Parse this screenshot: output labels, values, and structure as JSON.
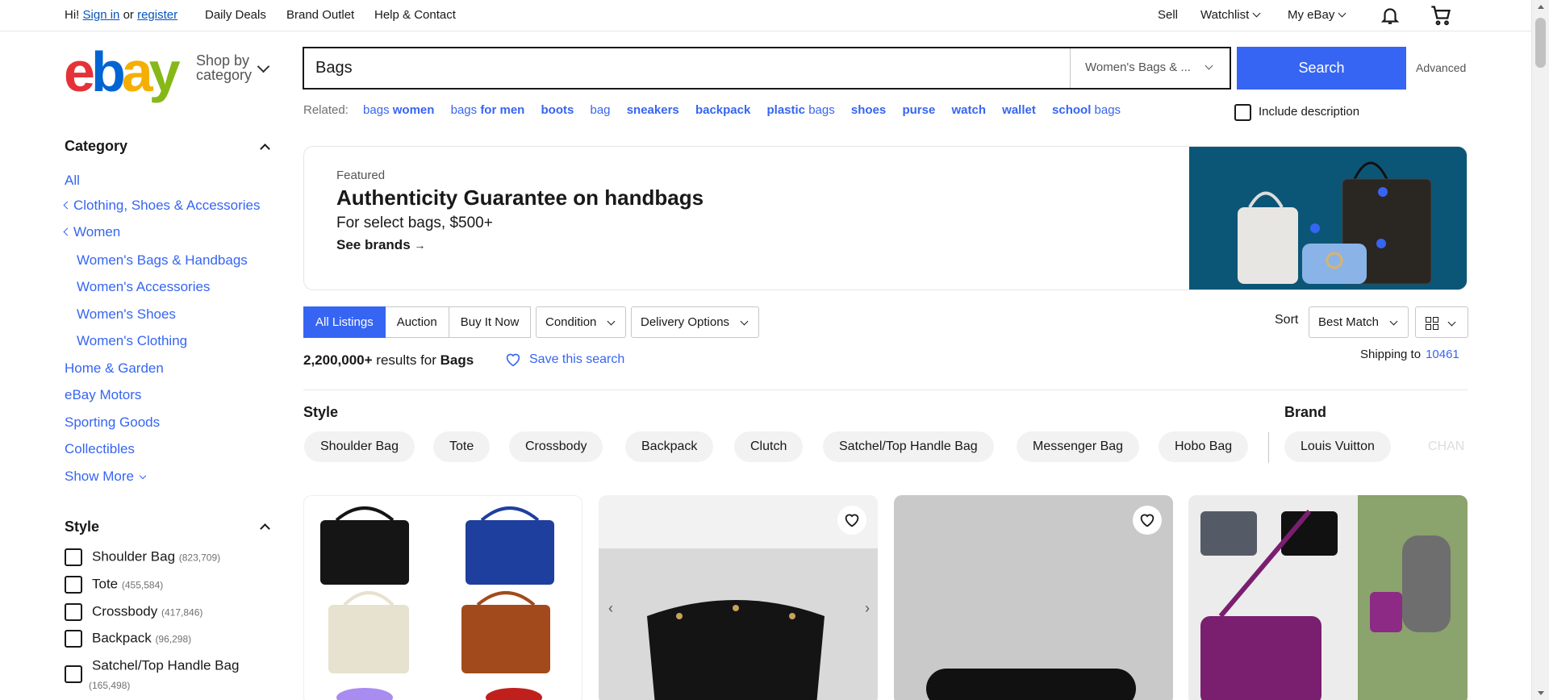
{
  "topbar": {
    "greeting": "Hi!",
    "sign_in": "Sign in",
    "or": "or",
    "register": "register",
    "daily_deals": "Daily Deals",
    "brand_outlet": "Brand Outlet",
    "help_contact": "Help & Contact",
    "sell": "Sell",
    "watchlist": "Watchlist",
    "my_ebay": "My eBay",
    "notification_icon": "bell-icon",
    "cart_icon": "cart-icon"
  },
  "header": {
    "logo": "ebay",
    "shop_by_category_line1": "Shop by",
    "shop_by_category_line2": "category"
  },
  "search": {
    "value": "Bags",
    "category_selected": "Women's Bags & ...",
    "button": "Search",
    "advanced": "Advanced"
  },
  "related": {
    "label": "Related:",
    "items": [
      {
        "pre": "bags ",
        "bold": "women",
        "post": ""
      },
      {
        "pre": "bags ",
        "bold": "for men",
        "post": ""
      },
      {
        "pre": "",
        "bold": "boots",
        "post": ""
      },
      {
        "pre": "bag",
        "bold": "",
        "post": ""
      },
      {
        "pre": "",
        "bold": "sneakers",
        "post": ""
      },
      {
        "pre": "",
        "bold": "backpack",
        "post": ""
      },
      {
        "pre": "",
        "bold": "plastic",
        "post": " bags"
      },
      {
        "pre": "",
        "bold": "shoes",
        "post": ""
      },
      {
        "pre": "",
        "bold": "purse",
        "post": ""
      },
      {
        "pre": "",
        "bold": "watch",
        "post": ""
      },
      {
        "pre": "",
        "bold": "wallet",
        "post": ""
      },
      {
        "pre": "",
        "bold": "school",
        "post": " bags"
      }
    ],
    "include_description": "Include description"
  },
  "sidebar": {
    "category_heading": "Category",
    "categories": [
      "All",
      "Clothing, Shoes & Accessories",
      "Women",
      "Women's Bags & Handbags",
      "Women's Accessories",
      "Women's Shoes",
      "Women's Clothing",
      "Home & Garden",
      "eBay Motors",
      "Sporting Goods",
      "Collectibles"
    ],
    "show_more": "Show More",
    "style_heading": "Style",
    "styles": [
      {
        "label": "Shoulder Bag",
        "count": "(823,709)"
      },
      {
        "label": "Tote",
        "count": "(455,584)"
      },
      {
        "label": "Crossbody",
        "count": "(417,846)"
      },
      {
        "label": "Backpack",
        "count": "(96,298)"
      },
      {
        "label": "Satchel/Top Handle Bag",
        "count": "(165,498)"
      }
    ]
  },
  "banner": {
    "featured": "Featured",
    "title": "Authenticity Guarantee on handbags",
    "subtitle": "For select bags, $500+",
    "cta": "See brands",
    "bg_color": "#0a5a7a"
  },
  "listing_tabs": [
    "All Listings",
    "Auction",
    "Buy It Now"
  ],
  "filters": {
    "condition": "Condition",
    "delivery": "Delivery Options",
    "sort_label": "Sort",
    "sort_value": "Best Match"
  },
  "results": {
    "count": "2,200,000+",
    "results_for": " results for ",
    "query": "Bags",
    "save_search": "Save this search",
    "shipping_to": "Shipping to",
    "zip": "10461"
  },
  "style_filter": {
    "heading": "Style",
    "chips": [
      "Shoulder Bag",
      "Tote",
      "Crossbody",
      "Backpack",
      "Clutch",
      "Satchel/Top Handle Bag",
      "Messenger Bag",
      "Hobo Bag"
    ]
  },
  "brand_filter": {
    "heading": "Brand",
    "chips": [
      "Louis Vuitton",
      "CHAN"
    ]
  },
  "colors": {
    "accent": "#3665f3",
    "link": "#0654ba"
  }
}
